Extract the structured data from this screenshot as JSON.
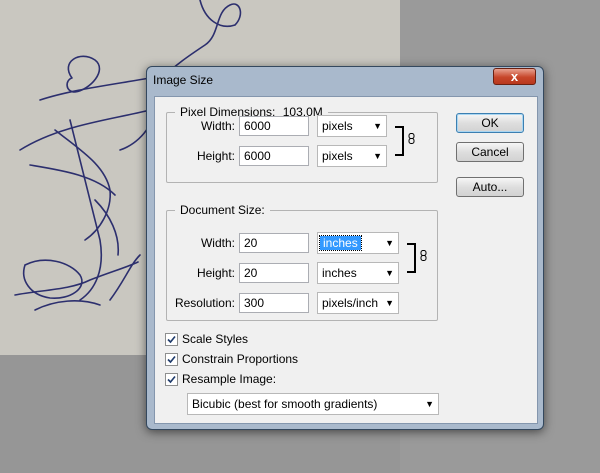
{
  "dialog": {
    "title": "Image Size",
    "close_glyph": "x",
    "buttons": {
      "ok": "OK",
      "cancel": "Cancel",
      "auto": "Auto..."
    }
  },
  "pixel_dimensions": {
    "legend_prefix": "Pixel Dimensions:",
    "legend_value": "103.0M",
    "width": {
      "label": "Width:",
      "value": "6000",
      "unit": "pixels"
    },
    "height": {
      "label": "Height:",
      "value": "6000",
      "unit": "pixels"
    }
  },
  "document_size": {
    "legend": "Document Size:",
    "width": {
      "label": "Width:",
      "value": "20",
      "unit": "inches"
    },
    "height": {
      "label": "Height:",
      "value": "20",
      "unit": "inches"
    },
    "resolution": {
      "label": "Resolution:",
      "value": "300",
      "unit": "pixels/inch"
    }
  },
  "options": {
    "scale_styles": {
      "label": "Scale Styles",
      "checked": true
    },
    "constrain_proportions": {
      "label": "Constrain Proportions",
      "checked": true
    },
    "resample_image": {
      "label": "Resample Image:",
      "checked": true
    },
    "resample_method": "Bicubic (best for smooth gradients)"
  },
  "icons": {
    "close": "close-icon",
    "dropdown": "chevron-down-icon",
    "link": "chain-link-icon",
    "check": "checkmark-icon"
  },
  "colors": {
    "frame": "#a9b9cc",
    "close": "#c7462a",
    "selection": "#3399ff",
    "sketch_ink": "#2c2f6e"
  }
}
